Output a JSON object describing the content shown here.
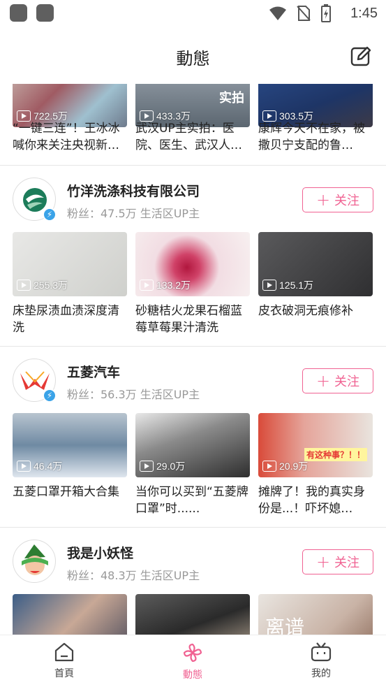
{
  "status_bar": {
    "time": "1:45"
  },
  "header": {
    "title": "動態"
  },
  "top_card": {
    "videos": [
      {
        "views": "722.5万",
        "title": "“一键三连”！王冰冰喊你来关注央视新…"
      },
      {
        "views": "433.3万",
        "overlay": "实拍",
        "title": "武汉UP主实拍：医院、医生、武汉人…"
      },
      {
        "views": "303.5万",
        "title": "康辉今天不在家，被撒贝宁支配的鲁…"
      }
    ]
  },
  "cards": [
    {
      "name": "竹洋洗涤科技有限公司",
      "meta": "粉丝：47.5万 生活区UP主",
      "follow": "关注",
      "videos": [
        {
          "views": "255.3万",
          "title": "床垫尿渍血渍深度清洗"
        },
        {
          "views": "133.2万",
          "title": "砂糖桔火龙果石榴蓝莓草莓果汁清洗"
        },
        {
          "views": "125.1万",
          "title": "皮衣破洞无痕修补"
        }
      ]
    },
    {
      "name": "五菱汽车",
      "meta": "粉丝：56.3万 生活区UP主",
      "follow": "关注",
      "videos": [
        {
          "views": "46.4万",
          "title": "五菱口罩开箱大合集"
        },
        {
          "views": "29.0万",
          "title": "当你可以买到“五菱牌口罩”时......"
        },
        {
          "views": "20.9万",
          "overlay": "有这种事？！！",
          "title": "摊牌了！我的真实身份是...！吓坏媳…"
        }
      ]
    },
    {
      "name": "我是小妖怪",
      "meta": "粉丝：48.3万 生活区UP主",
      "follow": "关注",
      "videos": [
        {
          "views": "",
          "title": ""
        },
        {
          "views": "",
          "title": ""
        },
        {
          "views": "",
          "overlay": "离谱",
          "title": ""
        }
      ]
    }
  ],
  "bottom_nav": [
    {
      "label": "首頁",
      "icon": "home-icon"
    },
    {
      "label": "動態",
      "icon": "pinwheel-icon",
      "active": true
    },
    {
      "label": "我的",
      "icon": "tv-icon"
    }
  ],
  "colors": {
    "accent": "#f06292",
    "verified": "#3aa3e8",
    "muted": "#999999"
  }
}
